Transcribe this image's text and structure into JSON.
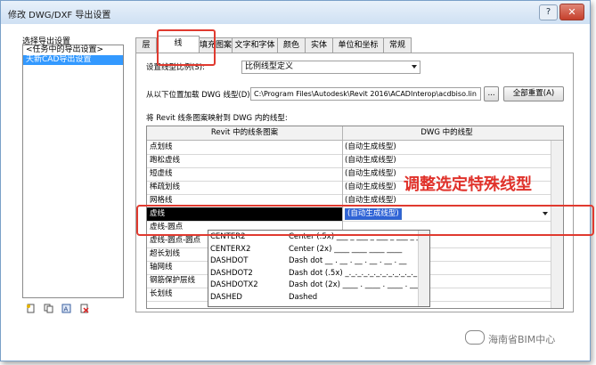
{
  "window": {
    "title": "修改 DWG/DXF 导出设置",
    "help_label": "?",
    "close_label": "✕"
  },
  "left_panel": {
    "label": "选择导出设置",
    "items": [
      {
        "label": "<任务中的导出设置>",
        "selected": false
      },
      {
        "label": "天新CAD导出设置",
        "selected": true
      }
    ],
    "icons": [
      "new-setting-icon",
      "duplicate-setting-icon",
      "rename-setting-icon",
      "delete-setting-icon"
    ]
  },
  "tabs": [
    "层",
    "线",
    "填充图案",
    "文字和字体",
    "颜色",
    "实体",
    "单位和坐标",
    "常规"
  ],
  "active_tab": "线",
  "panel": {
    "scale_label": "设置线型比例(S):",
    "scale_value": "比例线型定义",
    "load_label": "从以下位置加载 DWG 线型(D):",
    "load_path": "C:\\Program Files\\Autodesk\\Revit 2016\\ACADInterop\\acdbiso.lin",
    "browse_label": "...",
    "reset_label": "全部重置(A)",
    "map_label": "将 Revit 线条图案映射到 DWG 内的线型:",
    "grid": {
      "col1_header": "Revit 中的线条图案",
      "col2_header": "DWG 中的线型",
      "rows": [
        {
          "pattern": "点划线",
          "dwg": "(自动生成线型)"
        },
        {
          "pattern": "跑松虚线",
          "dwg": "(自动生成线型)"
        },
        {
          "pattern": "短虚线",
          "dwg": "(自动生成线型)"
        },
        {
          "pattern": "稀疏划线",
          "dwg": "(自动生成线型)"
        },
        {
          "pattern": "网格线",
          "dwg": "(自动生成线型)"
        },
        {
          "pattern": "虚线",
          "dwg": "(自动生成线型)",
          "selected": true
        },
        {
          "pattern": "虚线-圆点",
          "dwg": ""
        },
        {
          "pattern": "虚线-圆点-圆点",
          "dwg": ""
        },
        {
          "pattern": "超长划线",
          "dwg": ""
        },
        {
          "pattern": "轴网线",
          "dwg": ""
        },
        {
          "pattern": "钢筋保护层线",
          "dwg": ""
        },
        {
          "pattern": "长划线",
          "dwg": ""
        }
      ]
    },
    "dropdown_options": [
      {
        "name": "CENTER2",
        "desc": "Center (.5x) ___ _ ___ _ ___ _ ___ _ ___"
      },
      {
        "name": "CENTERX2",
        "desc": "Center (2x) ____ ____ ____ ____"
      },
      {
        "name": "DASHDOT",
        "desc": "Dash dot __ . __ . __ . __ . __ . __"
      },
      {
        "name": "DASHDOT2",
        "desc": "Dash dot (.5x) _._._._._._._._._._._._"
      },
      {
        "name": "DASHDOTX2",
        "desc": "Dash dot (2x) ____ . ____ . ____ . ___"
      },
      {
        "name": "DASHED",
        "desc": "Dashed"
      }
    ]
  },
  "annotation": "调整选定特殊线型",
  "watermark": "海南省BIM中心",
  "colors": {
    "annotation_red": "#e0322b",
    "selection_blue": "#3399ff"
  }
}
